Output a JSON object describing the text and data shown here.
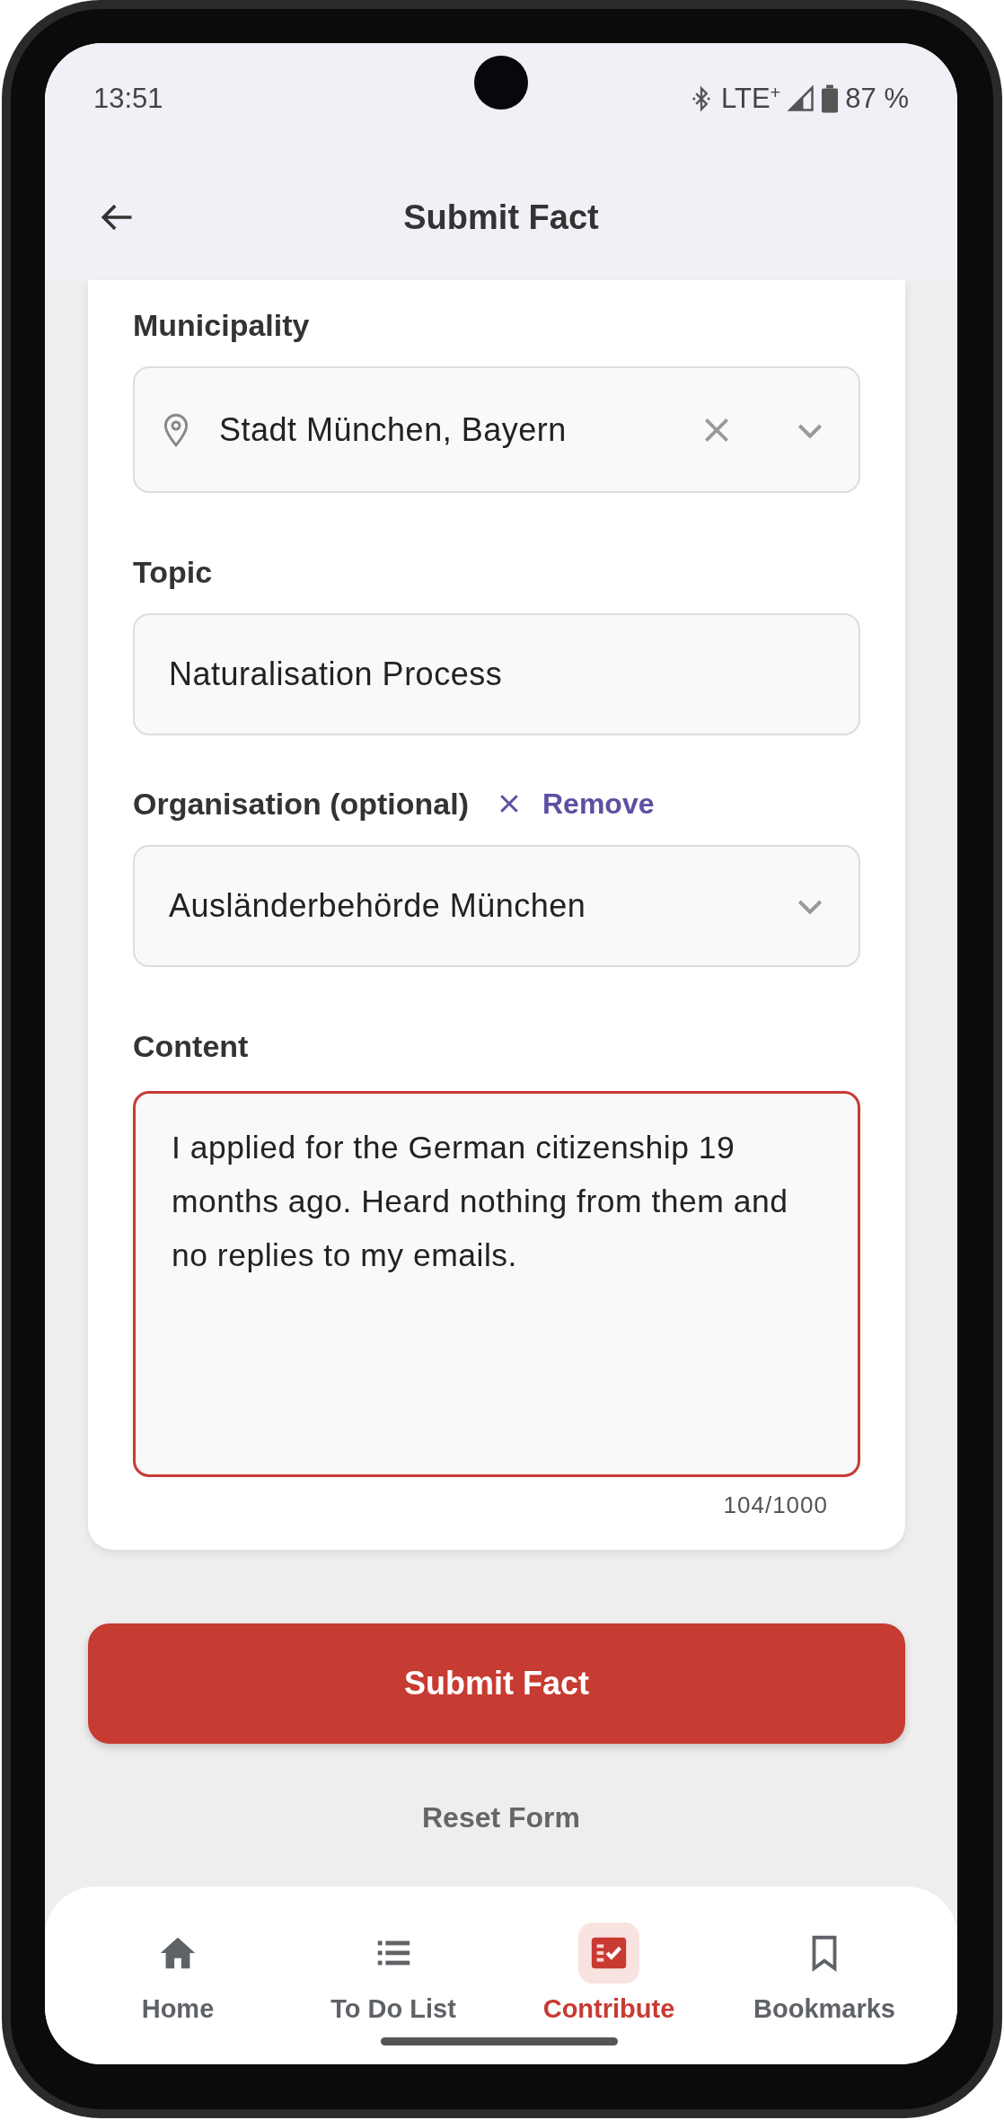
{
  "status_bar": {
    "time": "13:51",
    "network": "LTE$^{+}$",
    "battery": "87 %"
  },
  "app_bar": {
    "title": "Submit Fact"
  },
  "form": {
    "municipality": {
      "label": "Municipality",
      "value": "Stadt München, Bayern"
    },
    "topic": {
      "label": "Topic",
      "value": "Naturalisation Process"
    },
    "organisation": {
      "label": "Organisation (optional)",
      "remove": "Remove",
      "value": "Ausländerbehörde München"
    },
    "content": {
      "label": "Content",
      "value": "I applied for the German citizenship 19 months ago. Heard nothing from them and no replies to my emails.",
      "counter": "104/1000",
      "focused": true
    }
  },
  "submit_button": "Submit Fact",
  "reset_button": "Reset Form",
  "nav": [
    {
      "label": "Home",
      "selected": false
    },
    {
      "label": "To Do List",
      "selected": false
    },
    {
      "label": "Contribute",
      "selected": true
    },
    {
      "label": "Bookmarks",
      "selected": false
    }
  ]
}
